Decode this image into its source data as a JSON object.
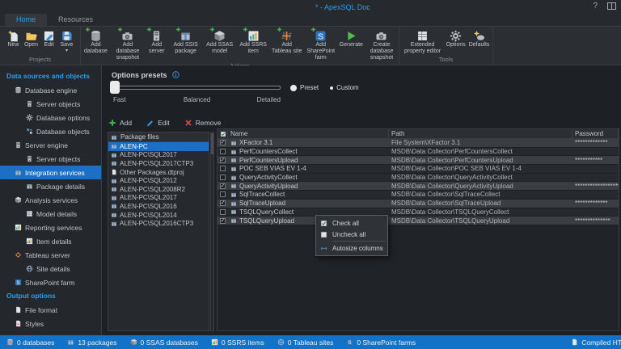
{
  "window": {
    "title": "* - ApexSQL Doc"
  },
  "tabs": [
    {
      "label": "Home",
      "active": true
    },
    {
      "label": "Resources",
      "active": false
    }
  ],
  "ribbon": {
    "groups": [
      {
        "label": "Projects",
        "buttons": [
          {
            "label": "New",
            "icon": "new-page"
          },
          {
            "label": "Open",
            "icon": "folder"
          },
          {
            "label": "Edit",
            "icon": "pencil"
          },
          {
            "label": "Save",
            "icon": "floppy",
            "dropdown": true
          }
        ]
      },
      {
        "label": "Actions",
        "buttons": [
          {
            "label": "Add database",
            "icon": "database",
            "plus": true
          },
          {
            "label": "Add database snapshot",
            "icon": "camera",
            "plus": true
          },
          {
            "label": "Add server",
            "icon": "server",
            "plus": true
          },
          {
            "label": "Add SSIS package",
            "icon": "package",
            "plus": true
          },
          {
            "label": "Add SSAS model",
            "icon": "cube",
            "plus": true
          },
          {
            "label": "Add SSRS item",
            "icon": "chart",
            "plus": true
          },
          {
            "label": "Add Tableau site",
            "icon": "tableau",
            "plus": true
          },
          {
            "label": "Add SharePoint farm",
            "icon": "sharepoint",
            "plus": true
          },
          {
            "label": "Generate",
            "icon": "play"
          },
          {
            "label": "Create database snapshot",
            "icon": "camera"
          }
        ]
      },
      {
        "label": "Tools",
        "buttons": [
          {
            "label": "Extended property editor",
            "icon": "grid"
          },
          {
            "label": "Options",
            "icon": "gear"
          },
          {
            "label": "Defaults",
            "icon": "sparkle"
          }
        ]
      }
    ]
  },
  "sidebar": {
    "sections": [
      {
        "header": "Data sources and objects",
        "items": [
          {
            "label": "Database engine",
            "level": 0,
            "icon": "database"
          },
          {
            "label": "Server objects",
            "level": 1,
            "icon": "server"
          },
          {
            "label": "Database options",
            "level": 1,
            "icon": "gear"
          },
          {
            "label": "Database objects",
            "level": 1,
            "icon": "objects"
          },
          {
            "label": "Server engine",
            "level": 0,
            "icon": "server"
          },
          {
            "label": "Server objects",
            "level": 1,
            "icon": "server"
          },
          {
            "label": "Integration services",
            "level": 0,
            "icon": "package",
            "selected": true
          },
          {
            "label": "Package details",
            "level": 1,
            "icon": "package"
          },
          {
            "label": "Analysis services",
            "level": 0,
            "icon": "cube"
          },
          {
            "label": "Model details",
            "level": 1,
            "icon": "grid"
          },
          {
            "label": "Reporting services",
            "level": 0,
            "icon": "chart"
          },
          {
            "label": "Item details",
            "level": 1,
            "icon": "chart"
          },
          {
            "label": "Tableau server",
            "level": 0,
            "icon": "diamond"
          },
          {
            "label": "Site details",
            "level": 1,
            "icon": "globe"
          },
          {
            "label": "SharePoint farm",
            "level": 0,
            "icon": "sharepoint"
          }
        ]
      },
      {
        "header": "Output options",
        "items": [
          {
            "label": "File format",
            "level": 0,
            "icon": "document"
          },
          {
            "label": "Styles",
            "level": 0,
            "icon": "document-red"
          }
        ]
      }
    ]
  },
  "options_presets": {
    "title": "Options presets",
    "slider_labels": [
      "Fast",
      "Balanced",
      "Detailed"
    ],
    "slider_position": "Fast",
    "radios": [
      {
        "label": "Preset",
        "selected": true
      },
      {
        "label": "Custom",
        "selected": false
      }
    ]
  },
  "list_toolbar": [
    {
      "label": "Add",
      "icon": "plus"
    },
    {
      "label": "Edit",
      "icon": "pencil-blue"
    },
    {
      "label": "Remove",
      "icon": "cross"
    }
  ],
  "package_panel": {
    "header": "Package files",
    "selected_index": 0,
    "items": [
      {
        "label": "ALEN-PC",
        "icon": "package"
      },
      {
        "label": "ALEN-PC\\SQL2017",
        "icon": "package"
      },
      {
        "label": "ALEN-PC\\SQL2017CTP3",
        "icon": "package"
      },
      {
        "label": "Other Packages.dtproj",
        "icon": "document"
      },
      {
        "label": "ALEN-PC\\SQL2012",
        "icon": "package"
      },
      {
        "label": "ALEN-PC\\SQL2008R2",
        "icon": "package"
      },
      {
        "label": "ALEN-PC\\SQL2017",
        "icon": "package"
      },
      {
        "label": "ALEN-PC\\SQL2016",
        "icon": "package"
      },
      {
        "label": "ALEN-PC\\SQL2014",
        "icon": "package"
      },
      {
        "label": "ALEN-PC\\SQL2016CTP3",
        "icon": "package"
      }
    ]
  },
  "table": {
    "columns": [
      "Name",
      "Path",
      "Password"
    ],
    "rows": [
      {
        "checked": true,
        "name": "XFactor 3.1",
        "path": "File System\\XFactor 3.1",
        "password": "*************"
      },
      {
        "checked": false,
        "name": "PerfCountersCollect",
        "path": "MSDB\\Data Collector\\PerfCountersCollect",
        "password": ""
      },
      {
        "checked": true,
        "name": "PerfCountersUpload",
        "path": "MSDB\\Data Collector\\PerfCountersUpload",
        "password": "***********"
      },
      {
        "checked": false,
        "name": "POC SEB VIAS EV 1-4",
        "path": "MSDB\\Data Collector\\POC SEB VIAS EV 1-4",
        "password": ""
      },
      {
        "checked": false,
        "name": "QueryActivityCollect",
        "path": "MSDB\\Data Collector\\QueryActivityCollect",
        "password": ""
      },
      {
        "checked": true,
        "name": "QueryActivityUpload",
        "path": "MSDB\\Data Collector\\QueryActivityUpload",
        "password": "******************"
      },
      {
        "checked": false,
        "name": "SqlTraceCollect",
        "path": "MSDB\\Data Collector\\SqlTraceCollect",
        "password": ""
      },
      {
        "checked": true,
        "name": "SqlTraceUpload",
        "path": "MSDB\\Data Collector\\SqlTraceUpload",
        "password": "*************"
      },
      {
        "checked": false,
        "name": "TSQLQueryCollect",
        "path": "MSDB\\Data Collector\\TSQLQueryCollect",
        "password": ""
      },
      {
        "checked": true,
        "name": "TSQLQueryUpload",
        "path": "MSDB\\Data Collector\\TSQLQueryUpload",
        "password": "**************"
      }
    ]
  },
  "context_menu": {
    "items": [
      {
        "label": "Check all",
        "icon": "checkbox-checked"
      },
      {
        "label": "Uncheck all",
        "icon": "checkbox"
      },
      {
        "label": "Autosize columns",
        "icon": "autosize",
        "separator_before": true
      }
    ]
  },
  "status_bar": {
    "items": [
      {
        "label": "0 databases",
        "icon": "database"
      },
      {
        "label": "13 packages",
        "icon": "package"
      },
      {
        "label": "0 SSAS databases",
        "icon": "cube"
      },
      {
        "label": "0 SSRS items",
        "icon": "chart"
      },
      {
        "label": "0 Tableau sites",
        "icon": "globe"
      },
      {
        "label": "0 SharePoint farms",
        "icon": "sharepoint"
      }
    ],
    "right": {
      "label": "Compiled HTM",
      "icon": "document"
    }
  },
  "colors": {
    "accent_blue": "#2d9fe8",
    "selection_blue": "#1b6fc4",
    "status_bar_blue": "#1172c8",
    "add_green": "#4caf50",
    "remove_red": "#d64541"
  }
}
